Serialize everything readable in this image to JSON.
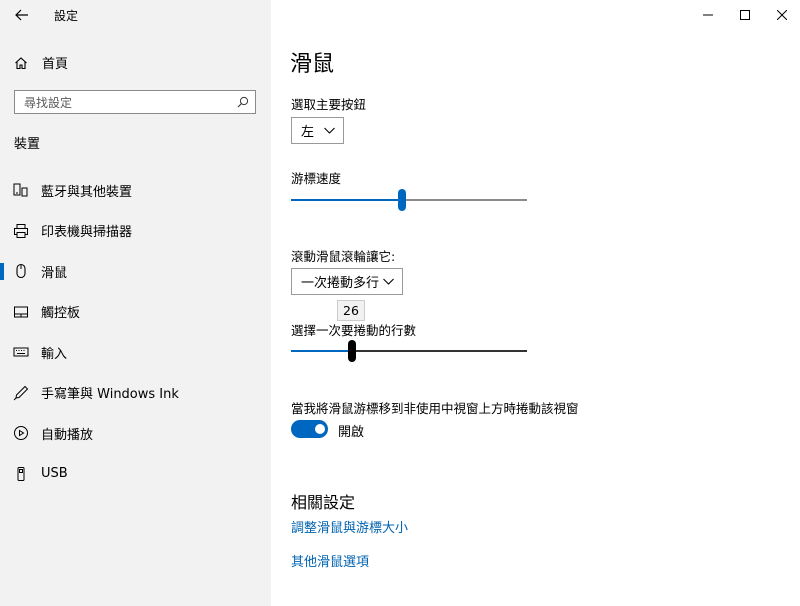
{
  "window": {
    "title": "設定",
    "controls": [
      "minimize",
      "maximize",
      "close"
    ]
  },
  "sidebar": {
    "home_label": "首頁",
    "search_placeholder": "尋找設定",
    "section": "裝置",
    "items": [
      {
        "label": "藍牙與其他裝置",
        "icon": "bluetooth-devices-icon"
      },
      {
        "label": "印表機與掃描器",
        "icon": "printer-icon"
      },
      {
        "label": "滑鼠",
        "icon": "mouse-icon",
        "selected": true
      },
      {
        "label": "觸控板",
        "icon": "touchpad-icon"
      },
      {
        "label": "輸入",
        "icon": "keyboard-icon"
      },
      {
        "label": "手寫筆與 Windows Ink",
        "icon": "pen-icon"
      },
      {
        "label": "自動播放",
        "icon": "autoplay-icon"
      },
      {
        "label": "USB",
        "icon": "usb-icon"
      }
    ]
  },
  "main": {
    "title": "滑鼠",
    "primary_button": {
      "label": "選取主要按鈕",
      "value": "左"
    },
    "cursor_speed": {
      "label": "游標速度",
      "value_fraction": 0.47
    },
    "scroll_mode": {
      "label": "滾動滑鼠滾輪讓它:",
      "value": "一次捲動多行"
    },
    "scroll_lines": {
      "label": "選擇一次要捲動的行數",
      "value": "26",
      "value_fraction": 0.25
    },
    "inactive_scroll": {
      "label": "當我將滑鼠游標移到非使用中視窗上方時捲動該視窗",
      "state": "開啟",
      "on": true
    },
    "related": {
      "heading": "相關設定",
      "links": [
        "調整滑鼠與游標大小",
        "其他滑鼠選項"
      ]
    }
  },
  "colors": {
    "accent": "#0067c0",
    "link": "#0063b1",
    "sidebar_bg": "#f2f2f2"
  }
}
